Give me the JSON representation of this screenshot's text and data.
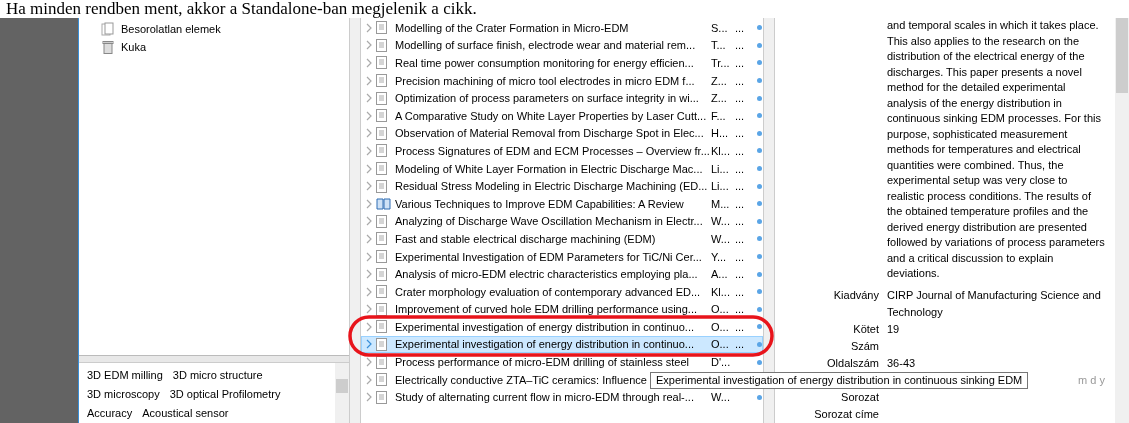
{
  "caption": "Ha minden rendben ment, akkor a Standalone-ban megjelenik a cikk.",
  "collections": [
    {
      "kind": "unfiled",
      "label": "Besorolatlan elemek"
    },
    {
      "kind": "trash",
      "label": "Kuka"
    }
  ],
  "tags": [
    "3D EDM milling",
    "3D micro structure",
    "3D microscopy",
    "3D optical Profilometry",
    "Accuracy",
    "Acoustical sensor"
  ],
  "items": [
    {
      "kind": "document",
      "title": "Modelling of the Crater Formation in Micro-EDM",
      "creator": "S...",
      "date": "...",
      "selected": false
    },
    {
      "kind": "document",
      "title": "Modelling of surface finish, electrode wear and material rem...",
      "creator": "T...",
      "date": "...",
      "selected": false
    },
    {
      "kind": "document",
      "title": "Real time power consumption monitoring for energy efficien...",
      "creator": "Tr...",
      "date": "...",
      "selected": false
    },
    {
      "kind": "document",
      "title": "Precision machining of micro tool electrodes in micro EDM f...",
      "creator": "Z...",
      "date": "...",
      "selected": false
    },
    {
      "kind": "document",
      "title": "Optimization of process parameters on surface integrity in wi...",
      "creator": "Z...",
      "date": "...",
      "selected": false
    },
    {
      "kind": "document",
      "title": "A Comparative Study on White Layer Properties by Laser Cutt...",
      "creator": "F...",
      "date": "...",
      "selected": false
    },
    {
      "kind": "document",
      "title": "Observation of Material Removal from Discharge Spot in Elec...",
      "creator": "H...",
      "date": "...",
      "selected": false
    },
    {
      "kind": "document",
      "title": "Process Signatures of EDM and ECM Processes – Overview fr...",
      "creator": "Kl...",
      "date": "...",
      "selected": false
    },
    {
      "kind": "document",
      "title": "Modeling of White Layer Formation in Electric Discharge Mac...",
      "creator": "Li...",
      "date": "...",
      "selected": false
    },
    {
      "kind": "document",
      "title": "Residual Stress Modeling in Electric Discharge Machining (ED...",
      "creator": "Li...",
      "date": "...",
      "selected": false
    },
    {
      "kind": "book",
      "title": "Various Techniques to Improve EDM Capabilities: A Review",
      "creator": "M...",
      "date": "...",
      "selected": false
    },
    {
      "kind": "document",
      "title": "Analyzing of Discharge Wave Oscillation Mechanism in Electr...",
      "creator": "W...",
      "date": "...",
      "selected": false
    },
    {
      "kind": "document",
      "title": "Fast and stable electrical discharge machining (EDM)",
      "creator": "W...",
      "date": "...",
      "selected": false
    },
    {
      "kind": "document",
      "title": "Experimental Investigation of EDM Parameters for TiC/Ni Cer...",
      "creator": "Y...",
      "date": "...",
      "selected": false
    },
    {
      "kind": "document",
      "title": "Analysis of micro-EDM electric characteristics employing pla...",
      "creator": "A...",
      "date": "...",
      "selected": false
    },
    {
      "kind": "document",
      "title": "Crater morphology evaluation of contemporary advanced ED...",
      "creator": "Kl...",
      "date": "...",
      "selected": false
    },
    {
      "kind": "document",
      "title": "Improvement of curved hole EDM drilling performance using...",
      "creator": "O...",
      "date": "...",
      "selected": false
    },
    {
      "kind": "document",
      "title": "Experimental investigation of energy distribution in continuo...",
      "creator": "O...",
      "date": "...",
      "selected": false
    },
    {
      "kind": "document",
      "title": "Experimental investigation of energy distribution in continuo...",
      "creator": "O...",
      "date": "...",
      "selected": true
    },
    {
      "kind": "document",
      "title": "Process performance of micro-EDM drilling of stainless steel",
      "creator": "D'...",
      "selected": false
    },
    {
      "kind": "document",
      "title": "Electrically conductive ZTA–TiC ceramics: Influence",
      "selected": false
    },
    {
      "kind": "document",
      "title": "Study of alternating current flow in micro-EDM through real-...",
      "creator": "W...",
      "selected": false
    }
  ],
  "abstract": "and temporal scales in which it takes place. This also applies to the research on the distribution of the electrical energy of the discharges. This paper presents a novel method for the detailed experimental analysis of the energy distribution in continuous sinking EDM processes. For this purpose, sophisticated measurement methods for temperatures and electrical quantities were combined. Thus, the experimental setup was very close to realistic process conditions. The results of the obtained temperature profiles and the derived energy distribution are presented followed by variations of process parameters and a critical discussion to explain deviations.",
  "fields": [
    {
      "label": "Kiadvány",
      "value": "CIRP Journal of Manufacturing Science and Technology"
    },
    {
      "label": "Kötet",
      "value": "19"
    },
    {
      "label": "Szám"
    },
    {
      "label": "Oldalszám",
      "value": "36-43"
    },
    {
      "hint": "m d y"
    },
    {
      "label": "Sorozat"
    },
    {
      "label": "Sorozat címe"
    }
  ],
  "tooltip": "Experimental investigation of energy distribution in continuous sinking EDM"
}
